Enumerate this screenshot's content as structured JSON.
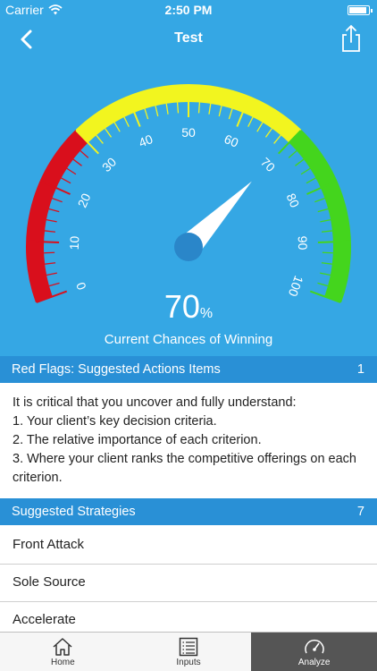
{
  "status": {
    "carrier": "Carrier",
    "time": "2:50 PM"
  },
  "nav": {
    "title": "Test"
  },
  "gauge": {
    "value_percent": 70,
    "tick_labels": [
      "0",
      "10",
      "20",
      "30",
      "40",
      "50",
      "60",
      "70",
      "80",
      "90",
      "100"
    ],
    "colors": {
      "red": "#d90f1c",
      "yellow": "#f2f51f",
      "green": "#44d51d",
      "background": "#35a7e4"
    }
  },
  "result": {
    "value": "70",
    "unit": "%",
    "caption": "Current Chances of Winning"
  },
  "red_flags": {
    "title": "Red Flags: Suggested Actions Items",
    "count": "1",
    "lines": [
      "It is critical that you uncover and fully understand:",
      "1. Your client’s key decision criteria.",
      "2. The relative importance of each criterion.",
      "3. Where your client ranks the competitive offerings on each criterion."
    ]
  },
  "strategies": {
    "title": "Suggested Strategies",
    "count": "7",
    "items": [
      "Front Attack",
      "Sole Source",
      "Accelerate"
    ]
  },
  "tabs": [
    {
      "label": "Home",
      "icon": "home-icon"
    },
    {
      "label": "Inputs",
      "icon": "list-icon"
    },
    {
      "label": "Analyze",
      "icon": "speedometer-icon"
    }
  ],
  "accent_color": "#2990d6"
}
